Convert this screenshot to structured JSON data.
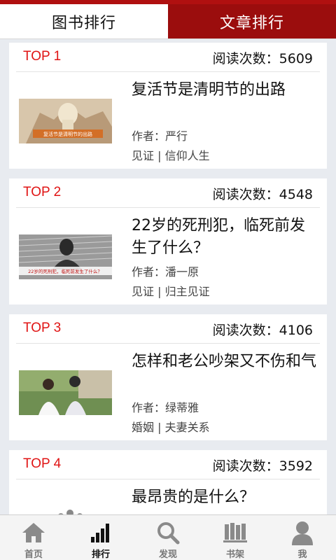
{
  "tabs": [
    {
      "label": "图书排行",
      "active": false
    },
    {
      "label": "文章排行",
      "active": true
    }
  ],
  "accent_color": "#9b0d0d",
  "rank_color": "#e01414",
  "reads_prefix": "阅读次数：",
  "articles": [
    {
      "rank": "TOP 1",
      "reads": "阅读次数：5609",
      "title": "复活节是清明节的出路",
      "author": "作者：严行",
      "tags": "见证 | 信仰人生",
      "thumb_caption": "复活节是清明节的出路"
    },
    {
      "rank": "TOP 2",
      "reads": "阅读次数：4548",
      "title": "22岁的死刑犯，临死前发生了什么？",
      "author": "作者：潘一原",
      "tags": "见证 | 归主见证",
      "thumb_caption": "22岁的死刑犯，临死前发生了什么？"
    },
    {
      "rank": "TOP 3",
      "reads": "阅读次数：4106",
      "title": "怎样和老公吵架又不伤和气",
      "author": "作者：绿蒂雅",
      "tags": "婚姻 | 夫妻关系",
      "thumb_caption": ""
    },
    {
      "rank": "TOP 4",
      "reads": "阅读次数：3592",
      "title": "最昂贵的是什么？",
      "author": "",
      "tags": "",
      "thumb_caption": ""
    }
  ],
  "bottom_nav": [
    {
      "label": "首页",
      "icon": "home-icon",
      "active": false
    },
    {
      "label": "排行",
      "icon": "ranking-bars-icon",
      "active": true
    },
    {
      "label": "发现",
      "icon": "search-icon",
      "active": false
    },
    {
      "label": "书架",
      "icon": "bookshelf-icon",
      "active": false
    },
    {
      "label": "我",
      "icon": "user-icon",
      "active": false
    }
  ]
}
